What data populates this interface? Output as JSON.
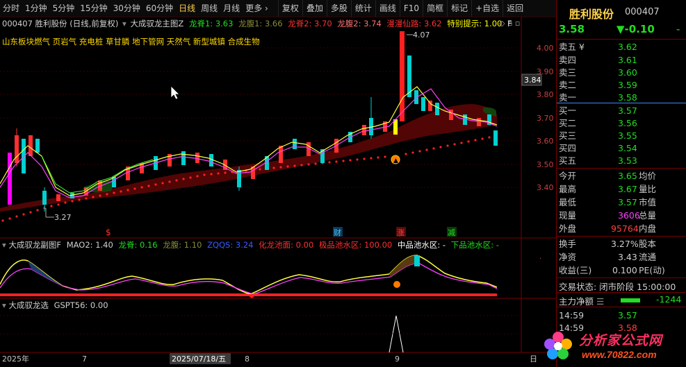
{
  "toolbar": {
    "left_items": [
      "分时",
      "1分钟",
      "5分钟",
      "15分钟",
      "30分钟",
      "60分钟",
      "日线",
      "周线",
      "月线",
      "更多 ›"
    ],
    "active_index": 6,
    "right_items": [
      "复权",
      "叠加",
      "多股",
      "统计",
      "画线",
      "F10",
      "简框",
      "标记",
      "+自选",
      "返回"
    ]
  },
  "main_chart": {
    "legend_code_name": "000407  胜利股份 (日线,前复权)",
    "indicator_name": "大成驭龙主图Z",
    "legend_items": [
      {
        "label": "龙脊1: 3.63",
        "color": "#22dd22"
      },
      {
        "label": "龙腹1: 3.66",
        "color": "#8a8a3a"
      },
      {
        "label": "龙脊2: 3.70",
        "color": "#ff3030"
      },
      {
        "label": "龙腹2: 3.74",
        "color": "#ff7070"
      },
      {
        "label": "漫漫仙路: 3.62",
        "color": "#ff3030"
      },
      {
        "label": "特别提示: 1.00",
        "color": "#ffff00"
      },
      {
        "label": "F",
        "color": "#ffffff"
      }
    ],
    "concepts": "山东板块燃气    页岩气 充电桩 草甘膦 地下管网 天然气 新型城镇 合成生物",
    "y_ticks": [
      "4.00",
      "3.90",
      "3.80",
      "3.70",
      "3.60",
      "3.50",
      "3.40"
    ],
    "price_tag": "3.84",
    "high_label": "4.07",
    "low_label": "3.27",
    "markers": [
      {
        "text": "$",
        "color": "#ff3030"
      },
      {
        "text": "财",
        "color": "#4fc3f7"
      },
      {
        "text": "涨",
        "color": "#ff4040"
      },
      {
        "text": "减",
        "color": "#22dd22"
      }
    ]
  },
  "sub1": {
    "title": "大成驭龙副图F",
    "items": [
      {
        "label": "MAO2: 1.40",
        "color": "#d0d0d0"
      },
      {
        "label": "龙脊: 0.16",
        "color": "#22dd22"
      },
      {
        "label": "龙腹: 1.10",
        "color": "#8a8a3a"
      },
      {
        "label": "ZQQS: 3.24",
        "color": "#3a5aff"
      },
      {
        "label": "化龙池面: 0.00",
        "color": "#ff3030"
      },
      {
        "label": "极品池水区: 100.00",
        "color": "#ff3030"
      },
      {
        "label": "中品池水区: -",
        "color": "#ffffff"
      },
      {
        "label": "下品池水区: -",
        "color": "#22dd22"
      }
    ]
  },
  "sub2": {
    "title": "大成驭龙选",
    "items": [
      {
        "label": "GSPT56: 0.00",
        "color": "#d0d0d0"
      }
    ]
  },
  "xaxis": {
    "labels": [
      "2025年",
      "7",
      "2025/07/18/五",
      "8",
      "9"
    ],
    "corner": "日"
  },
  "quote": {
    "name": "胜利股份",
    "code": "000407",
    "price": "3.58",
    "change": "▼-0.10",
    "change_right": "-",
    "asks": [
      {
        "label": "卖五 ¥",
        "price": "3.62",
        "vol": ""
      },
      {
        "label": "卖四",
        "price": "3.61",
        "vol": ""
      },
      {
        "label": "卖三",
        "price": "3.60",
        "vol": ""
      },
      {
        "label": "卖二",
        "price": "3.59",
        "vol": ""
      },
      {
        "label": "卖一",
        "price": "3.58",
        "vol": ""
      }
    ],
    "bids": [
      {
        "label": "买一",
        "price": "3.57",
        "vol": ""
      },
      {
        "label": "买二",
        "price": "3.56",
        "vol": ""
      },
      {
        "label": "买三",
        "price": "3.55",
        "vol": ""
      },
      {
        "label": "买四",
        "price": "3.54",
        "vol": ""
      },
      {
        "label": "买五",
        "price": "3.53",
        "vol": ""
      }
    ],
    "stats": [
      {
        "l1": "今开",
        "v1": "3.65",
        "l2": "均价",
        "v2": ""
      },
      {
        "l1": "最高",
        "v1": "3.67",
        "l2": "量比",
        "v2": ""
      },
      {
        "l1": "最低",
        "v1": "3.57",
        "l2": "市值",
        "v2": ""
      },
      {
        "l1": "现量",
        "v1": "3606",
        "l2": "总量",
        "v2": ""
      },
      {
        "l1": "外盘",
        "v1": "95764",
        "l2": "内盘",
        "v2": ""
      }
    ],
    "stats2": [
      {
        "l1": "换手",
        "v1": "3.27%",
        "l2": "股本"
      },
      {
        "l1": "净资",
        "v1": "3.43",
        "l2": "流通"
      },
      {
        "l1": "收益(三)",
        "v1": "0.100",
        "l2": "PE(动)"
      }
    ],
    "trade_status": "交易状态: 闭市阶段 15:00:00",
    "main_net_label": "主力净额",
    "main_net_value": "-1244",
    "ticks": [
      {
        "time": "14:59",
        "price": "3.57"
      },
      {
        "time": "14:59",
        "price": "3.58"
      }
    ]
  },
  "watermark": {
    "title": "分析家公式网",
    "url": "www.70822.com"
  }
}
